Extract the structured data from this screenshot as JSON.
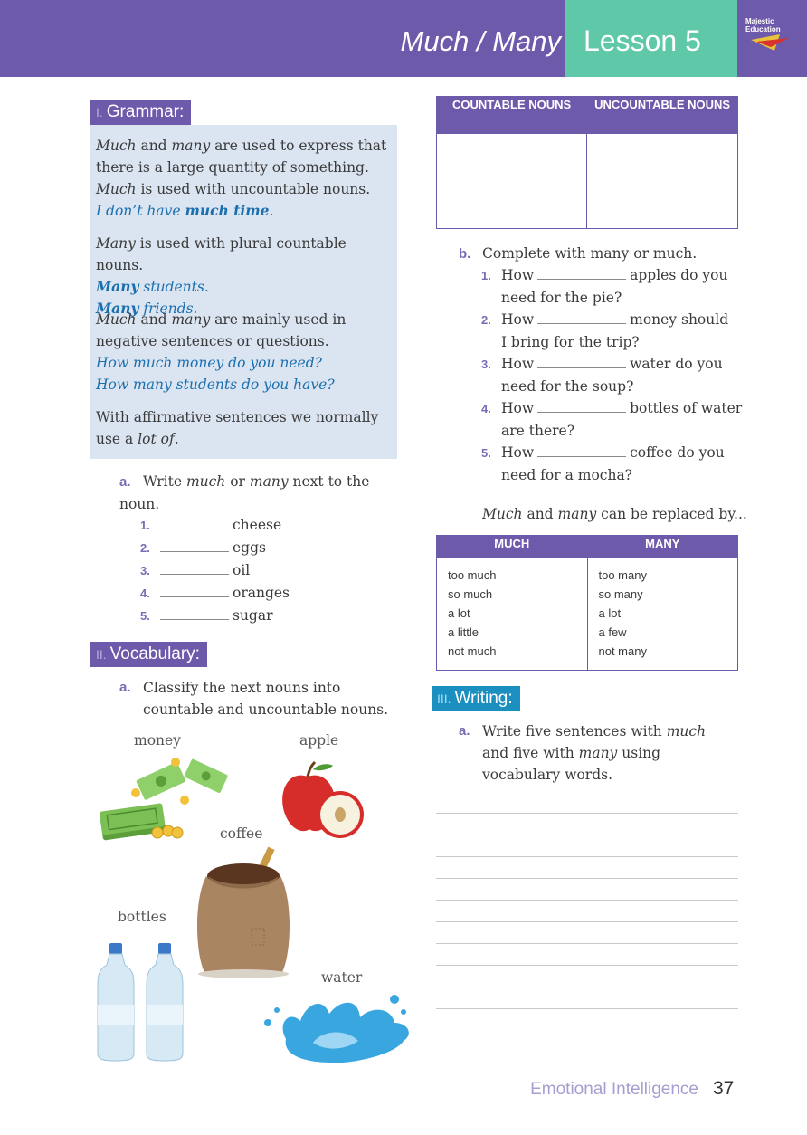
{
  "header": {
    "title": "Much / Many",
    "lesson": "Lesson 5",
    "logo_text": "Majestic Education"
  },
  "grammar": {
    "num": "I.",
    "heading": "Grammar:",
    "p1_much": "Much",
    "p1_and": " and ",
    "p1_many": "many",
    "p1_rest": " are used to express that there is a large quantity of something.",
    "p1b_much": "Much",
    "p1b_rest": " is used with uncountable nouns.",
    "ex1_a": "I don’t have ",
    "ex1_b": "much time",
    "ex1_c": ".",
    "p2_many": "Many",
    "p2_rest": " is used with plural countable nouns.",
    "ex2_bold": "Many",
    "ex2_rest": " students.",
    "ex3_bold": "Many",
    "ex3_rest": " friends.",
    "p3_much": "Much",
    "p3_and": " and ",
    "p3_many": "many",
    "p3_rest": " are mainly used in negative sentences or questions.",
    "ex4": "How much money do you need?",
    "ex5": "How many students do you have?",
    "p4_a": "With affirmative sentences we normally use a ",
    "p4_b": "lot of",
    "p4_c": "."
  },
  "exercise_a": {
    "label": "a.",
    "t1": "Write ",
    "t2": "much",
    "t3": " or ",
    "t4": "many",
    "t5": " next to the noun.",
    "items": [
      {
        "num": "1.",
        "word": "cheese"
      },
      {
        "num": "2.",
        "word": "eggs"
      },
      {
        "num": "3.",
        "word": "oil"
      },
      {
        "num": "4.",
        "word": "oranges"
      },
      {
        "num": "5.",
        "word": "sugar"
      }
    ]
  },
  "vocabulary": {
    "num": "II.",
    "heading": "Vocabulary:",
    "label": "a.",
    "instruction": "Classify the next nouns into countable and uncountable nouns.",
    "captions": {
      "money": "money",
      "apple": "apple",
      "coffee": "coffee",
      "bottles": "bottles",
      "water": "water"
    }
  },
  "noun_table": {
    "col1": "COUNTABLE NOUNS",
    "col2": "UNCOUNTABLE NOUNS"
  },
  "exercise_b": {
    "label": "b.",
    "instruction": "Complete with many or much.",
    "items": [
      {
        "num": "1.",
        "pre": "How",
        "post": "apples do you",
        "cont": "need for the pie?"
      },
      {
        "num": "2.",
        "pre": "How",
        "post": "money should",
        "cont": "I bring for the trip?"
      },
      {
        "num": "3.",
        "pre": "How",
        "post": "water do you",
        "cont": "need for the soup?"
      },
      {
        "num": "4.",
        "pre": "How",
        "post": "bottles of water",
        "cont": "are there?"
      },
      {
        "num": "5.",
        "pre": "How",
        "post": "coffee do you",
        "cont": "need for a mocha?"
      }
    ]
  },
  "replace": {
    "t1": "Much",
    "t2": " and ",
    "t3": "many",
    "t4": " can be replaced by...",
    "col1": "MUCH",
    "col2": "MANY",
    "much_items": [
      "too much",
      "so much",
      "a lot",
      "a little",
      "not much"
    ],
    "many_items": [
      "too many",
      "so many",
      "a lot",
      "a few",
      "not many"
    ]
  },
  "writing": {
    "num": "III.",
    "heading": "Writing:",
    "label": "a.",
    "t1": "Write five sentences with ",
    "t2": "much",
    "t3": " and five with ",
    "t4": "many",
    "t5": " using vocabulary words."
  },
  "footer": {
    "text": "Emotional Intelligence",
    "page": "37"
  },
  "colors": {
    "purple": "#6e5aab",
    "teal": "#5fc8a8",
    "grammar_box": "#dbe4f1",
    "writing_heading": "#1a8fc0",
    "example_blue": "#1a6fae"
  }
}
